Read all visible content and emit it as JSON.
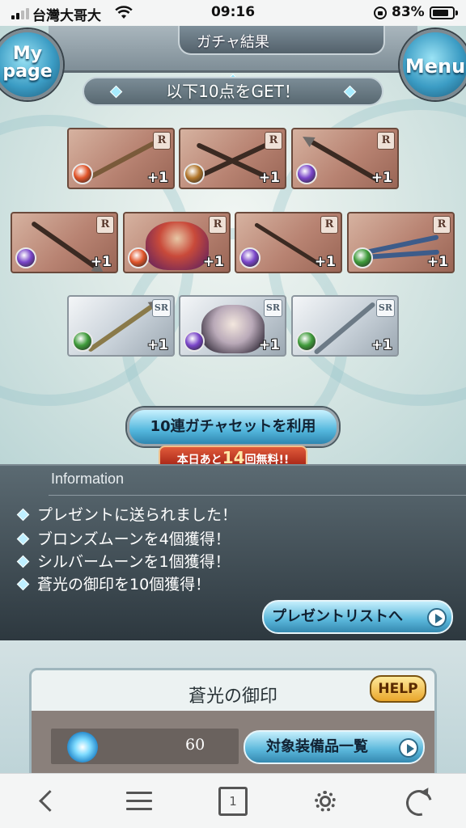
{
  "status_bar": {
    "carrier": "台灣大哥大",
    "time": "09:16",
    "battery_percent": "83%",
    "battery_level": 0.83,
    "signal_bars_active": 2,
    "icons": [
      "signal-icon",
      "wifi-icon",
      "orientation-lock-icon",
      "battery-icon"
    ]
  },
  "header": {
    "mypage_label": "My page",
    "title": "ガチャ結果",
    "menu_label": "Menu"
  },
  "result_banner": "以下10点をGET！",
  "items": {
    "row1": [
      {
        "rarity": "R",
        "element": "fire",
        "element_color": "#e1552a",
        "plus": "+1",
        "kind": "weapon"
      },
      {
        "rarity": "R",
        "element": "earth",
        "element_color": "#b3772c",
        "plus": "+1",
        "kind": "weapon"
      },
      {
        "rarity": "R",
        "element": "dark",
        "element_color": "#7a46c9",
        "plus": "+1",
        "kind": "weapon"
      }
    ],
    "row2": [
      {
        "rarity": "R",
        "element": "dark",
        "element_color": "#7a46c9",
        "plus": "+1",
        "kind": "weapon"
      },
      {
        "rarity": "R",
        "element": "fire",
        "element_color": "#e1552a",
        "plus": "+1",
        "kind": "summon"
      },
      {
        "rarity": "R",
        "element": "dark",
        "element_color": "#7a46c9",
        "plus": "+1",
        "kind": "weapon"
      },
      {
        "rarity": "R",
        "element": "wind",
        "element_color": "#3f9b3a",
        "plus": "+1",
        "kind": "weapon"
      }
    ],
    "row3": [
      {
        "rarity": "SR",
        "element": "wind",
        "element_color": "#3f9b3a",
        "plus": "+1",
        "kind": "weapon"
      },
      {
        "rarity": "SR",
        "element": "dark",
        "element_color": "#7a46c9",
        "plus": "+1",
        "kind": "character"
      },
      {
        "rarity": "SR",
        "element": "wind",
        "element_color": "#3f9b3a",
        "plus": "+1",
        "kind": "weapon"
      }
    ]
  },
  "use_set_button": "10連ガチャセットを利用",
  "free_notice": {
    "prefix": "本日あと",
    "count": "14",
    "suffix": "回無料!!"
  },
  "information": {
    "title": "Information",
    "lines": [
      "プレゼントに送られました！",
      "ブロンズムーンを4個獲得！",
      "シルバームーンを1個獲得！",
      "蒼光の御印を10個獲得！"
    ],
    "present_list_button": "プレゼントリストへ"
  },
  "seal_panel": {
    "title": "蒼光の御印",
    "help_label": "HELP",
    "count": "60",
    "equip_list_button": "対象装備品一覧"
  },
  "toolbar": {
    "tab_count": "1"
  },
  "colors": {
    "accent_blue": "#59b6da",
    "free_red": "#a01f12",
    "help_gold": "#e9a62b"
  }
}
